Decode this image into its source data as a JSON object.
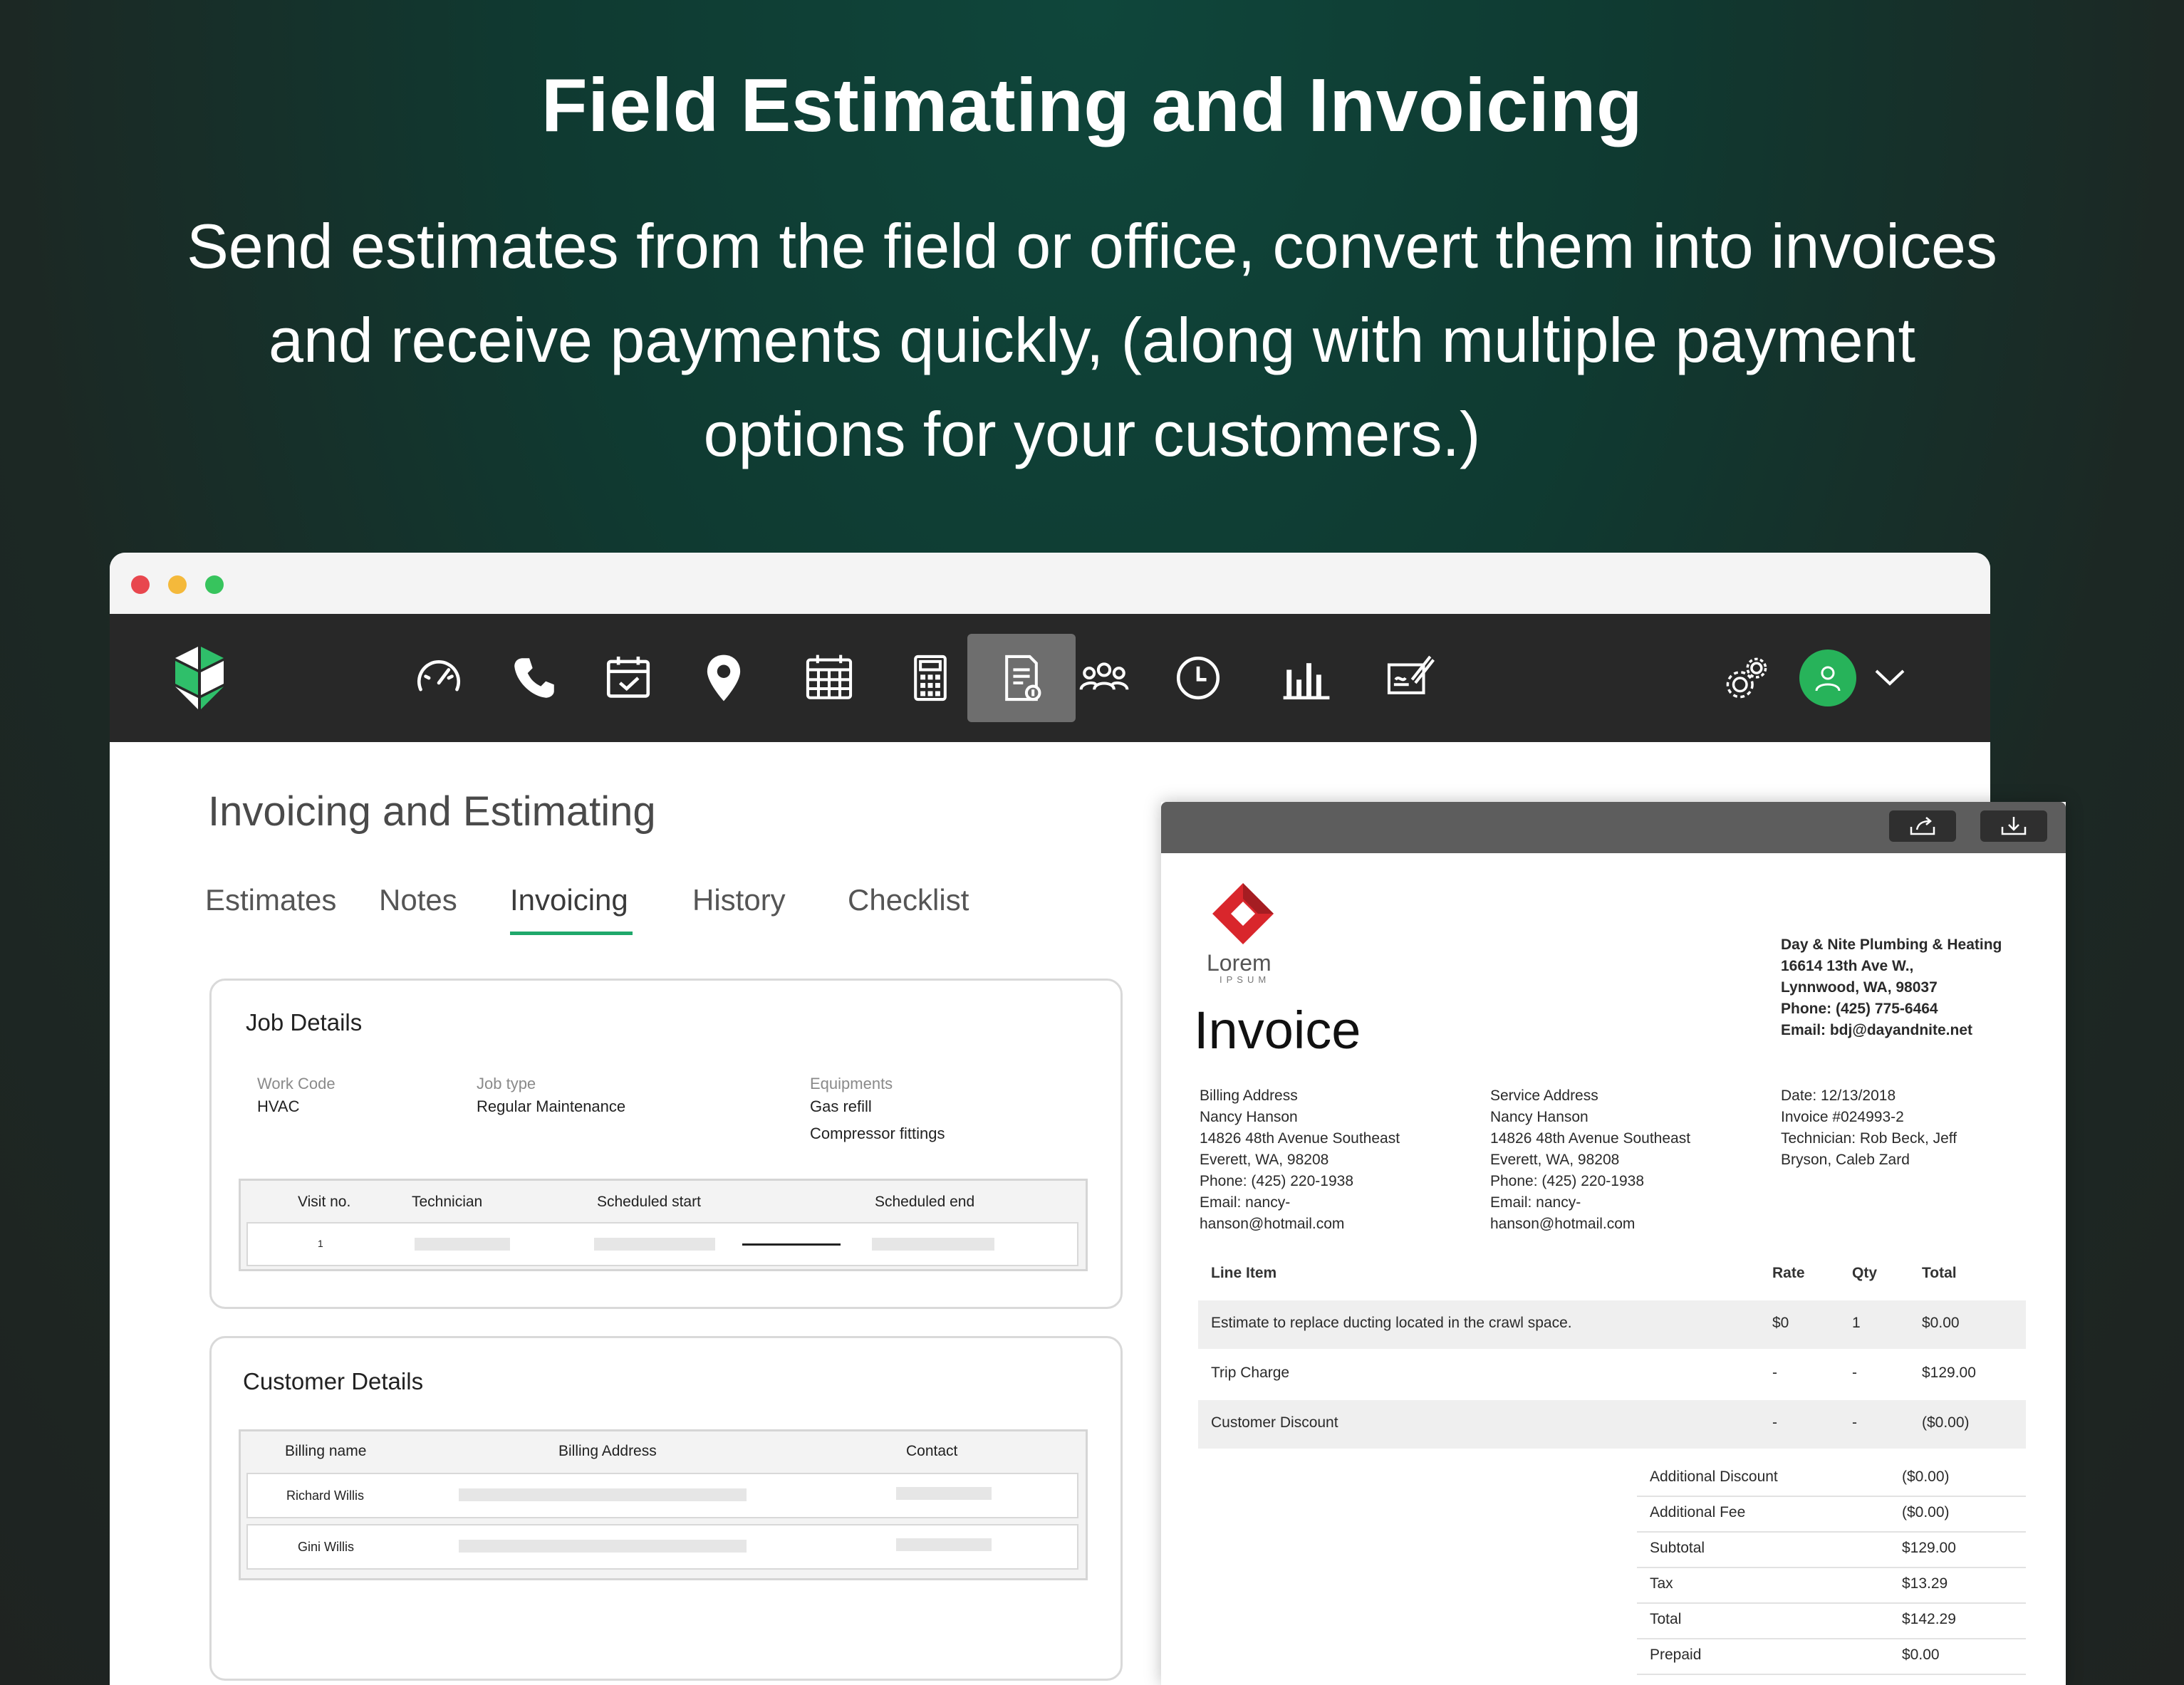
{
  "headline": "Field Estimating and Invoicing",
  "subheadline": [
    "Send estimates from the field or office, convert them into invoices",
    "and receive payments quickly, (along with multiple payment",
    "options for your customers.)"
  ],
  "window_controls": {
    "close": "#e8474e",
    "minimize": "#f4b93b",
    "maximize": "#37c45d"
  },
  "nav": {
    "icons": [
      "dashboard-icon",
      "phone-icon",
      "calendar-check-icon",
      "location-pin-icon",
      "schedule-grid-icon",
      "calculator-icon",
      "invoice-icon",
      "team-icon",
      "clock-icon",
      "reports-icon",
      "contract-sign-icon"
    ],
    "active": "invoice-icon",
    "accent": "#27b35a"
  },
  "page": {
    "title": "Invoicing and Estimating",
    "tabs": [
      "Estimates",
      "Notes",
      "Invoicing",
      "History",
      "Checklist"
    ],
    "active_tab": "Invoicing"
  },
  "job_details": {
    "title": "Job Details",
    "work_code_label": "Work Code",
    "work_code": "HVAC",
    "job_type_label": "Job type",
    "job_type": "Regular Maintenance",
    "equipments_label": "Equipments",
    "equipments": [
      "Gas refill",
      "Compressor fittings"
    ],
    "table_headers": [
      "Visit no.",
      "Technician",
      "Scheduled start",
      "Scheduled end"
    ],
    "rows": [
      {
        "visit_no": "1"
      }
    ]
  },
  "customer_details": {
    "title": "Customer Details",
    "table_headers": [
      "Billing name",
      "Billing Address",
      "Contact"
    ],
    "rows": [
      {
        "billing_name": "Richard Willis"
      },
      {
        "billing_name": "Gini Willis"
      }
    ]
  },
  "invoice": {
    "logo_name": "Lorem",
    "logo_sub": "IPSUM",
    "title": "Invoice",
    "company": "Day & Nite Plumbing & Heating\n16614 13th Ave W.,\nLynnwood, WA, 98037\nPhone: (425) 775-6464\nEmail: bdj@dayandnite.net",
    "billing_address": "Billing Address\nNancy Hanson\n14826 48th Avenue Southeast\nEverett, WA, 98208\nPhone: (425) 220-1938\nEmail: nancy-\nhanson@hotmail.com",
    "service_address": "Service Address\nNancy Hanson\n14826 48th Avenue Southeast\nEverett, WA, 98208\nPhone: (425) 220-1938\nEmail: nancy-\nhanson@hotmail.com",
    "meta": "Date: 12/13/2018\nInvoice #024993-2\nTechnician: Rob Beck, Jeff\nBryson, Caleb Zard",
    "columns": {
      "item": "Line Item",
      "rate": "Rate",
      "qty": "Qty",
      "total": "Total"
    },
    "line_items": [
      {
        "item": "Estimate to replace ducting located in the crawl space.",
        "rate": "$0",
        "qty": "1",
        "total": "$0.00"
      },
      {
        "item": "Trip Charge",
        "rate": "-",
        "qty": "-",
        "total": "$129.00"
      },
      {
        "item": "Customer Discount",
        "rate": "-",
        "qty": "-",
        "total": "($0.00)"
      }
    ],
    "totals": [
      {
        "label": "Additional Discount",
        "value": "($0.00)"
      },
      {
        "label": "Additional Fee",
        "value": "($0.00)"
      },
      {
        "label": "Subtotal",
        "value": "$129.00"
      },
      {
        "label": "Tax",
        "value": "$13.29"
      },
      {
        "label": "Total",
        "value": "$142.29"
      },
      {
        "label": "Prepaid",
        "value": "$0.00"
      }
    ]
  }
}
